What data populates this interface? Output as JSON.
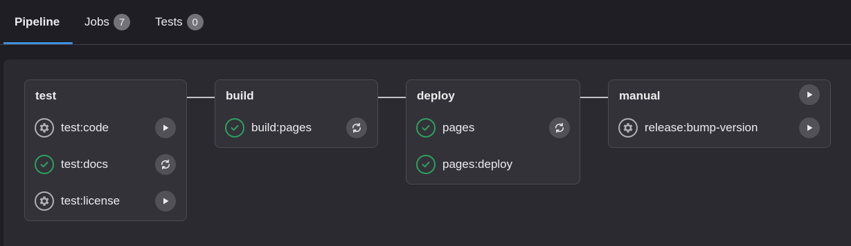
{
  "tabs": [
    {
      "label": "Pipeline",
      "active": true
    },
    {
      "label": "Jobs",
      "count": "7"
    },
    {
      "label": "Tests",
      "count": "0"
    }
  ],
  "stages": [
    {
      "title": "test",
      "jobs": [
        {
          "name": "test:code",
          "status": "manual",
          "action": "play"
        },
        {
          "name": "test:docs",
          "status": "success",
          "action": "retry"
        },
        {
          "name": "test:license",
          "status": "manual",
          "action": "play"
        }
      ]
    },
    {
      "title": "build",
      "jobs": [
        {
          "name": "build:pages",
          "status": "success",
          "action": "retry"
        }
      ]
    },
    {
      "title": "deploy",
      "jobs": [
        {
          "name": "pages",
          "status": "success",
          "action": "retry"
        },
        {
          "name": "pages:deploy",
          "status": "success",
          "action": null
        }
      ]
    },
    {
      "title": "manual",
      "stage_action": "play",
      "jobs": [
        {
          "name": "release:bump-version",
          "status": "manual",
          "action": "play"
        }
      ]
    }
  ],
  "colors": {
    "success": "#2da160",
    "manual": "#b1b1b6",
    "accent": "#428fdc"
  },
  "icons": {
    "success": "check-circle-icon",
    "manual": "gear-icon",
    "play": "play-icon",
    "retry": "retry-icon"
  }
}
